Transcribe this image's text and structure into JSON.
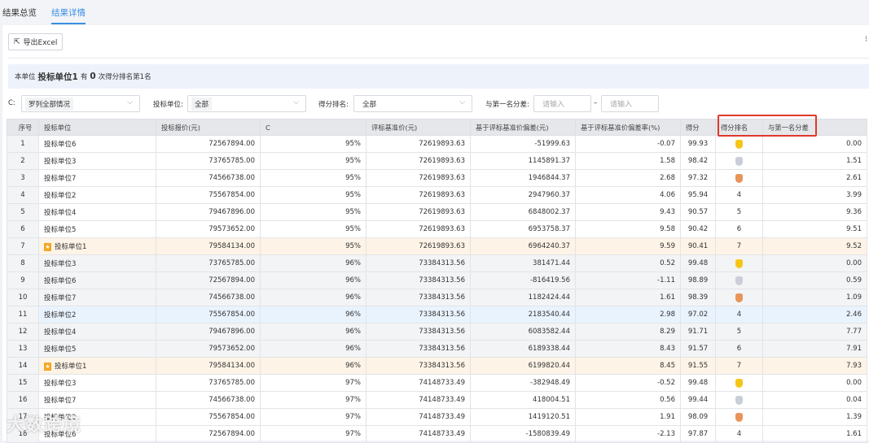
{
  "tabs": [
    {
      "label": "结果总览",
      "active": false
    },
    {
      "label": "结果详情",
      "active": true
    }
  ],
  "toolbar": {
    "export_label": "导出Excel",
    "more_icon": "more-icon"
  },
  "notice": {
    "prefix": "本单位",
    "unit": "投标单位1",
    "mid": "有",
    "count": "0",
    "suffix": "次得分排名第1名"
  },
  "filters": {
    "c_label": "C:",
    "c_value": "罗列全部情况",
    "unit_label": "投标单位:",
    "unit_value": "全部",
    "rank_label": "得分排名:",
    "rank_value": "全部",
    "diff_label": "与第一名分差:",
    "diff_from_placeholder": "请输入",
    "diff_sep": "–",
    "diff_to_placeholder": "请输入"
  },
  "table": {
    "headers": [
      "序号",
      "投标单位",
      "投标报价(元)",
      "C",
      "评标基准价(元)",
      "基于评标基准价偏差(元)",
      "基于评标基准价偏差率(%)",
      "得分",
      "得分排名",
      "与第一名分差"
    ],
    "rows": [
      [
        "1",
        "投标单位6",
        "72567894.00",
        "95%",
        "72619893.63",
        "-51999.63",
        "-0.07",
        "99.93",
        "1",
        "0.00"
      ],
      [
        "2",
        "投标单位3",
        "73765785.00",
        "95%",
        "72619893.63",
        "1145891.37",
        "1.58",
        "98.42",
        "2",
        "1.51"
      ],
      [
        "3",
        "投标单位7",
        "74566738.00",
        "95%",
        "72619893.63",
        "1946844.37",
        "2.68",
        "97.32",
        "3",
        "2.61"
      ],
      [
        "4",
        "投标单位2",
        "75567854.00",
        "95%",
        "72619893.63",
        "2947960.37",
        "4.06",
        "95.94",
        "4",
        "3.99"
      ],
      [
        "5",
        "投标单位4",
        "79467896.00",
        "95%",
        "72619893.63",
        "6848002.37",
        "9.43",
        "90.57",
        "5",
        "9.36"
      ],
      [
        "6",
        "投标单位5",
        "79573652.00",
        "95%",
        "72619893.63",
        "6953758.37",
        "9.58",
        "90.42",
        "6",
        "9.51"
      ],
      [
        "7",
        "投标单位1",
        "79584134.00",
        "95%",
        "72619893.63",
        "6964240.37",
        "9.59",
        "90.41",
        "7",
        "9.52"
      ],
      [
        "8",
        "投标单位3",
        "73765785.00",
        "96%",
        "73384313.56",
        "381471.44",
        "0.52",
        "99.48",
        "1",
        "0.00"
      ],
      [
        "9",
        "投标单位6",
        "72567894.00",
        "96%",
        "73384313.56",
        "-816419.56",
        "-1.11",
        "98.89",
        "2",
        "0.59"
      ],
      [
        "10",
        "投标单位7",
        "74566738.00",
        "96%",
        "73384313.56",
        "1182424.44",
        "1.61",
        "98.39",
        "3",
        "1.09"
      ],
      [
        "11",
        "投标单位2",
        "75567854.00",
        "96%",
        "73384313.56",
        "2183540.44",
        "2.98",
        "97.02",
        "4",
        "2.46"
      ],
      [
        "12",
        "投标单位4",
        "79467896.00",
        "96%",
        "73384313.56",
        "6083582.44",
        "8.29",
        "91.71",
        "5",
        "7.77"
      ],
      [
        "13",
        "投标单位5",
        "79573652.00",
        "96%",
        "73384313.56",
        "6189338.44",
        "8.43",
        "91.57",
        "6",
        "7.91"
      ],
      [
        "14",
        "投标单位1",
        "79584134.00",
        "96%",
        "73384313.56",
        "6199820.44",
        "8.45",
        "91.55",
        "7",
        "7.93"
      ],
      [
        "15",
        "投标单位3",
        "73765785.00",
        "97%",
        "74148733.49",
        "-382948.49",
        "-0.52",
        "99.48",
        "1",
        "0.00"
      ],
      [
        "16",
        "投标单位7",
        "74566738.00",
        "97%",
        "74148733.49",
        "418004.51",
        "0.56",
        "99.44",
        "2",
        "0.04"
      ],
      [
        "17",
        "投标单位2",
        "75567854.00",
        "97%",
        "74148733.49",
        "1419120.51",
        "1.91",
        "98.09",
        "3",
        "1.39"
      ],
      [
        "18",
        "投标单位6",
        "72567894.00",
        "97%",
        "74148733.49",
        "-1580839.49",
        "-2.13",
        "97.87",
        "4",
        "1.61"
      ]
    ],
    "self_unit": "投标单位1",
    "medal_colors": {
      "1": "#f5c518",
      "2": "#c9ced8",
      "3": "#e8955a"
    },
    "highlight_color": "#e0392b"
  },
  "watermark": "大数跨境"
}
